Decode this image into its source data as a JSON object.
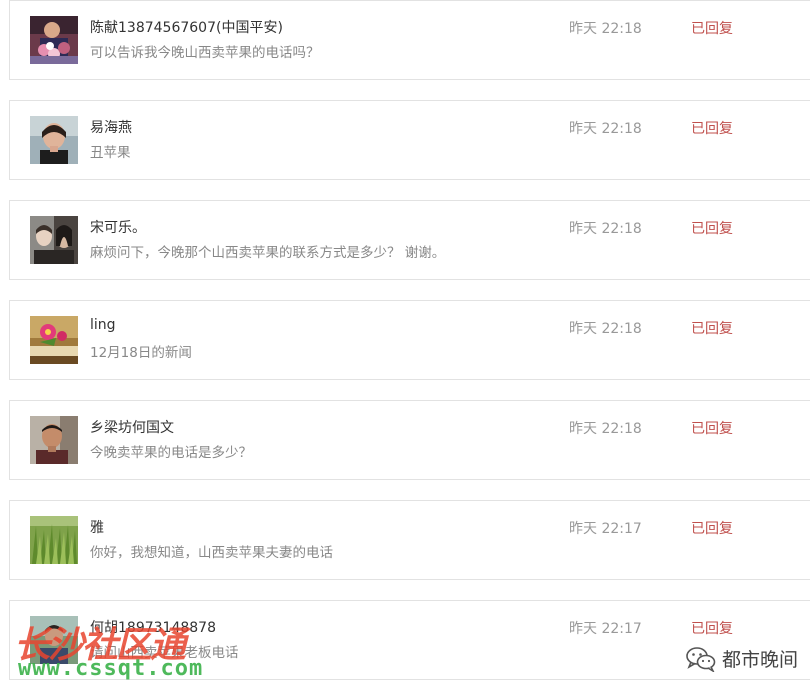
{
  "messages": [
    {
      "name": "陈献13874567607(中国平安)",
      "text": "可以告诉我今晚山西卖苹果的电话吗？",
      "time": "昨天 22:18",
      "status": "已回复",
      "avatar": "flowers-photo"
    },
    {
      "name": "易海燕",
      "text": "丑苹果",
      "time": "昨天 22:18",
      "status": "已回复",
      "avatar": "woman-portrait"
    },
    {
      "name": "宋可乐。",
      "text": "麻烦问下，今晚那个山西卖苹果的联系方式是多少？ 谢谢。",
      "time": "昨天 22:18",
      "status": "已回复",
      "avatar": "couple-photo"
    },
    {
      "name": "ling",
      "text": "12月18日的新闻",
      "time": "昨天 22:18",
      "status": "已回复",
      "avatar": "flower-book"
    },
    {
      "name": "乡梁坊何国文",
      "text": "今晚卖苹果的电话是多少？",
      "time": "昨天 22:18",
      "status": "已回复",
      "avatar": "man-portrait"
    },
    {
      "name": "雅",
      "text": "你好，我想知道，山西卖苹果夫妻的电话",
      "time": "昨天 22:17",
      "status": "已回复",
      "avatar": "grass-field"
    },
    {
      "name": "何胡18973148878",
      "text": "请问山西卖苹果老板电话",
      "time": "昨天 22:17",
      "status": "已回复",
      "avatar": "person-outdoor"
    }
  ],
  "watermark": {
    "site_name": "长沙社区通",
    "site_url": "www.cssqt.com",
    "brand": "都市晚间",
    "brand_icon": "wechat-icon"
  },
  "colors": {
    "status_red": "#c0504d",
    "border": "#e2e2e2",
    "watermark_red": "#e8452f",
    "watermark_green": "#3bb24a"
  }
}
